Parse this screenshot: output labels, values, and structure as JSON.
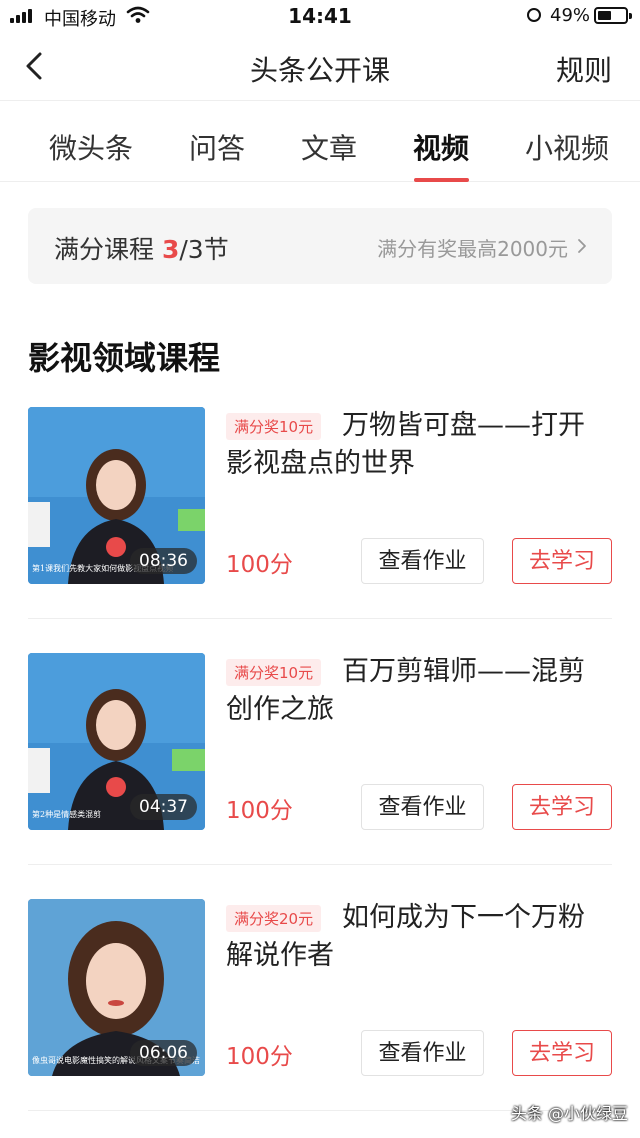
{
  "status_bar": {
    "carrier": "中国移动",
    "time": "14:41",
    "battery": "49%"
  },
  "nav": {
    "title": "头条公开课",
    "rules": "规则"
  },
  "tabs": [
    {
      "label": "微头条",
      "active": false
    },
    {
      "label": "问答",
      "active": false
    },
    {
      "label": "文章",
      "active": false
    },
    {
      "label": "视频",
      "active": true
    },
    {
      "label": "小视频",
      "active": false
    }
  ],
  "full_score": {
    "label": "满分课程",
    "done": "3",
    "total": "/3节",
    "right_text": "满分有奖最高2000元"
  },
  "section_title": "影视领域课程",
  "courses": [
    {
      "badge": "满分奖10元",
      "title": "万物皆可盘——打开影视盘点的世界",
      "duration": "08:36",
      "caption": "第1课我们先教大家如何做影视盘点视频",
      "score": "100分",
      "homework": "查看作业",
      "learn": "去学习"
    },
    {
      "badge": "满分奖10元",
      "title": "百万剪辑师——混剪创作之旅",
      "duration": "04:37",
      "caption": "第2种是情感类混剪",
      "score": "100分",
      "homework": "查看作业",
      "learn": "去学习"
    },
    {
      "badge": "满分奖20元",
      "title": "如何成为下一个万粉解说作者",
      "duration": "06:06",
      "caption": "像虫哥说电影魔性搞笑的解说风格文案节奏简洁",
      "score": "100分",
      "homework": "查看作业",
      "learn": "去学习"
    }
  ],
  "watermark": "头条 @小伙绿豆",
  "colors": {
    "accent": "#e84a4a",
    "badge_bg": "#fdecec",
    "bar_bg": "#f5f5f5",
    "thumb_bg": "#3f8fd1"
  }
}
